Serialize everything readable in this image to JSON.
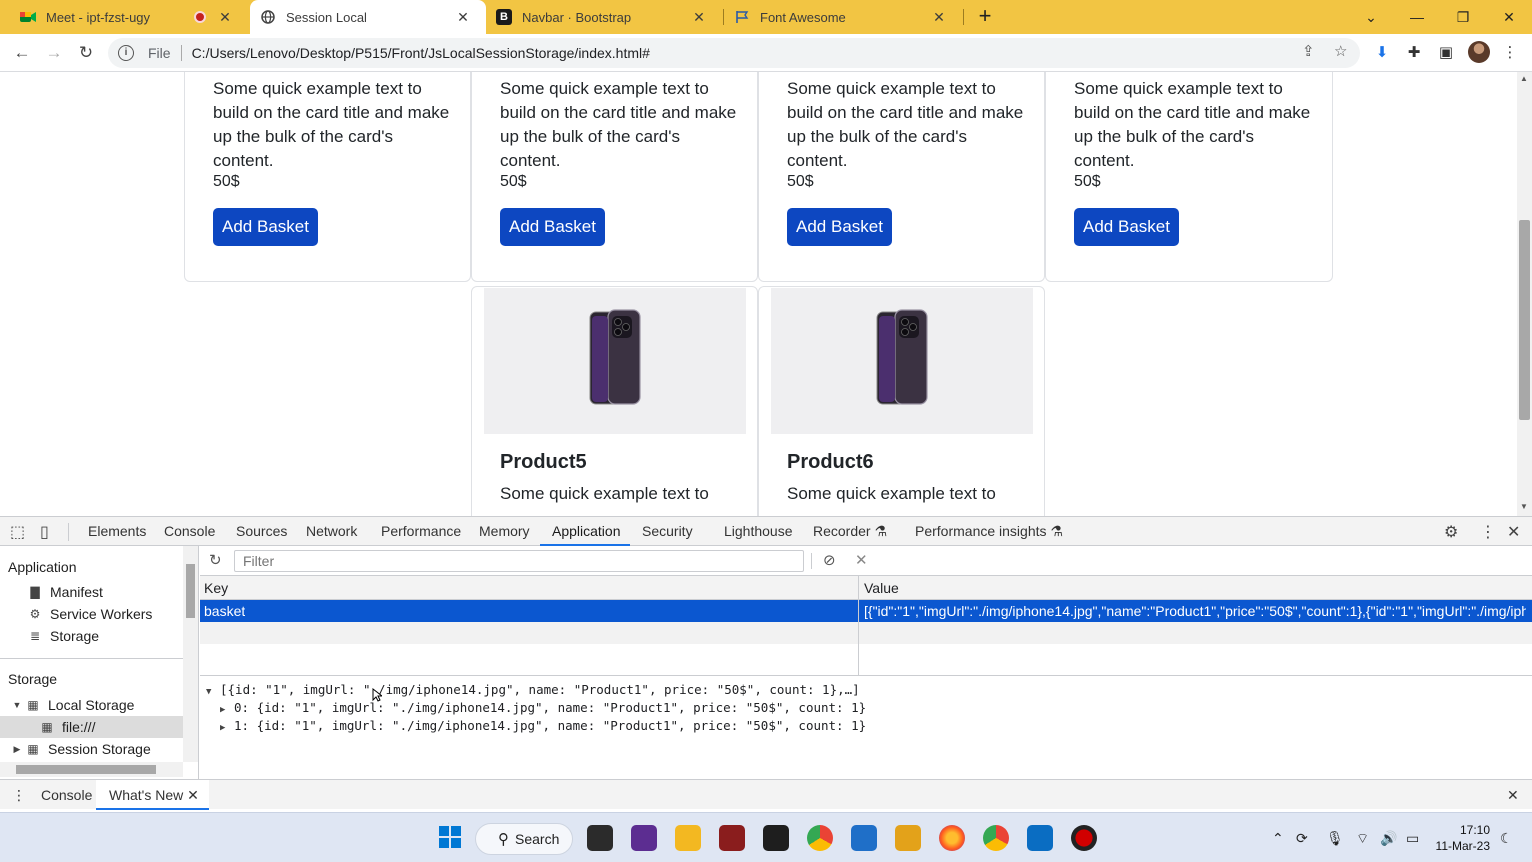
{
  "browser": {
    "tabs": [
      {
        "title": "Meet - ipt-fzst-ugy",
        "favicon": "google-meet-icon",
        "recording": true,
        "active": false
      },
      {
        "title": "Session Local",
        "favicon": "globe-icon",
        "active": true
      },
      {
        "title": "Navbar · Bootstrap",
        "favicon": "bootstrap-icon",
        "active": false
      },
      {
        "title": "Font Awesome",
        "favicon": "font-awesome-flag-icon",
        "active": false
      }
    ],
    "new_tab_label": "+",
    "address": {
      "scheme_label": "File",
      "url": "C:/Users/Lenovo/Desktop/P515/Front/JsLocalSessionStorage/index.html#"
    },
    "accent": "#f2c543"
  },
  "page": {
    "cards_top": [
      {
        "text": "Some quick example text to build on the card title and make up the bulk of the card's content.",
        "price": "50$",
        "button": "Add Basket"
      },
      {
        "text": "Some quick example text to build on the card title and make up the bulk of the card's content.",
        "price": "50$",
        "button": "Add Basket"
      },
      {
        "text": "Some quick example text to build on the card title and make up the bulk of the card's content.",
        "price": "50$",
        "button": "Add Basket"
      },
      {
        "text": "Some quick example text to build on the card title and make up the bulk of the card's content.",
        "price": "50$",
        "button": "Add Basket"
      }
    ],
    "cards_bottom": [
      {
        "title": "Product5",
        "text": "Some quick example text to"
      },
      {
        "title": "Product6",
        "text": "Some quick example text to"
      }
    ],
    "button_color": "#0d47c1"
  },
  "devtools": {
    "tabs": [
      "Elements",
      "Console",
      "Sources",
      "Network",
      "Performance",
      "Memory",
      "Application",
      "Security",
      "Lighthouse",
      "Recorder",
      "Performance insights"
    ],
    "active_tab": "Application",
    "sidebar": {
      "application_heading": "Application",
      "application_items": [
        "Manifest",
        "Service Workers",
        "Storage"
      ],
      "storage_heading": "Storage",
      "local_storage": "Local Storage",
      "local_storage_child": "file:///",
      "session_storage": "Session Storage"
    },
    "filter_placeholder": "Filter",
    "table": {
      "key_header": "Key",
      "value_header": "Value",
      "rows": [
        {
          "key": "basket",
          "value": "[{\"id\":\"1\",\"imgUrl\":\"./img/iphone14.jpg\",\"name\":\"Product1\",\"price\":\"50$\",\"count\":1},{\"id\":\"1\",\"imgUrl\":\"./img/iph..."
        }
      ]
    },
    "preview": {
      "root": "[{id: \"1\", imgUrl: \"./img/iphone14.jpg\", name: \"Product1\", price: \"50$\", count: 1},…]",
      "items": [
        "0: {id: \"1\", imgUrl: \"./img/iphone14.jpg\", name: \"Product1\", price: \"50$\", count: 1}",
        "1: {id: \"1\", imgUrl: \"./img/iphone14.jpg\", name: \"Product1\", price: \"50$\", count: 1}"
      ]
    },
    "drawer": {
      "console": "Console",
      "whats_new": "What's New"
    },
    "selection_color": "#0b57d0"
  },
  "taskbar": {
    "search_label": "Search",
    "time": "17:10",
    "date": "11-Mar-23"
  }
}
